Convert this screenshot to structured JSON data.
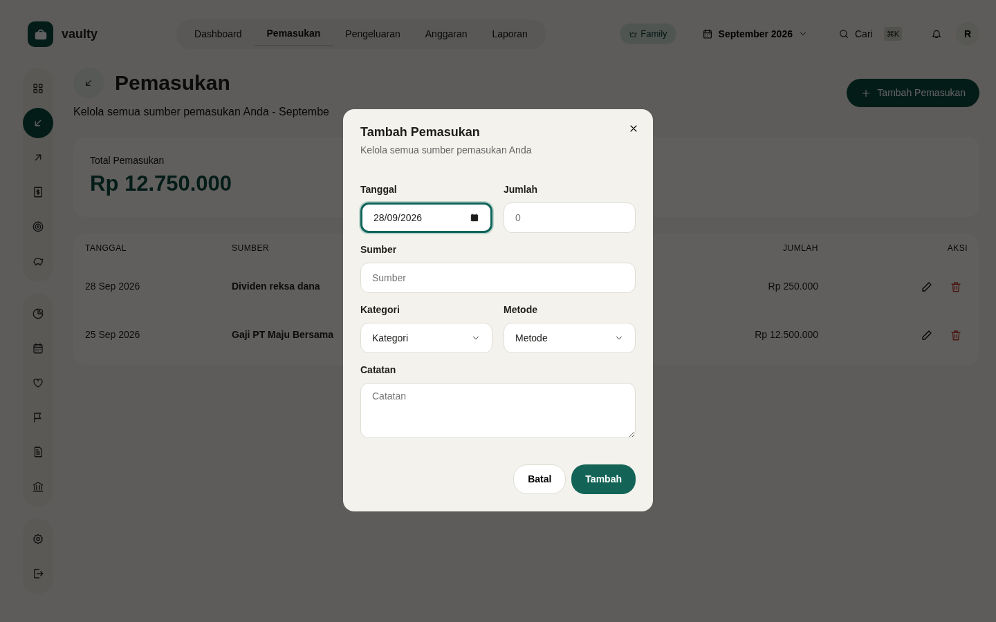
{
  "brand": {
    "name": "vaulty"
  },
  "nav_tabs": [
    {
      "label": "Dashboard",
      "selected": false
    },
    {
      "label": "Pemasukan",
      "selected": true
    },
    {
      "label": "Pengeluaran",
      "selected": false
    },
    {
      "label": "Anggaran",
      "selected": false
    },
    {
      "label": "Laporan",
      "selected": false
    }
  ],
  "plan_badge": "Family",
  "period": "September 2026",
  "search": {
    "placeholder": "Cari",
    "shortcut": "⌘K"
  },
  "avatar": "R",
  "sidebar": {
    "groups": [
      [
        {
          "selected": false
        },
        {
          "selected": true
        },
        {
          "selected": false
        },
        {
          "selected": false
        },
        {
          "selected": false
        },
        {
          "selected": false
        }
      ],
      [
        {
          "selected": false
        },
        {
          "selected": false
        },
        {
          "selected": false
        },
        {
          "selected": false
        },
        {
          "selected": false
        },
        {
          "selected": false
        }
      ],
      [
        {
          "selected": false
        },
        {
          "selected": false
        }
      ]
    ]
  },
  "page": {
    "title": "Pemasukan",
    "subtitle": "Kelola semua sumber pemasukan Anda - Septembe",
    "add_button": "Tambah Pemasukan"
  },
  "summary": {
    "label": "Total Pemasukan",
    "value": "Rp 12.750.000"
  },
  "table": {
    "columns": [
      "TANGGAL",
      "SUMBER",
      "JUMLAH",
      "AKSI"
    ],
    "rows": [
      {
        "date": "28 Sep 2026",
        "source": "Dividen reksa dana",
        "amount": "Rp 250.000"
      },
      {
        "date": "25 Sep 2026",
        "source": "Gaji PT Maju Bersama",
        "amount": "Rp 12.500.000"
      }
    ]
  },
  "dialog": {
    "title": "Tambah Pemasukan",
    "subtitle": "Kelola semua sumber pemasukan Anda",
    "fields": [
      {
        "kind": "date",
        "label": "Tanggal",
        "value": "28/09/2026",
        "focused": true
      },
      {
        "kind": "text",
        "label": "Jumlah",
        "placeholder": "0",
        "focused": false
      },
      {
        "kind": "text",
        "label": "Sumber",
        "placeholder": "Sumber",
        "focused": false,
        "wide": true
      },
      {
        "kind": "select",
        "label": "Kategori",
        "value": "Kategori",
        "focused": false
      },
      {
        "kind": "select",
        "label": "Metode",
        "value": "Metode",
        "focused": false
      },
      {
        "kind": "textarea",
        "label": "Catatan",
        "placeholder": "Catatan",
        "focused": false,
        "wide": true
      }
    ],
    "cancel": "Batal",
    "submit": "Tambah"
  }
}
